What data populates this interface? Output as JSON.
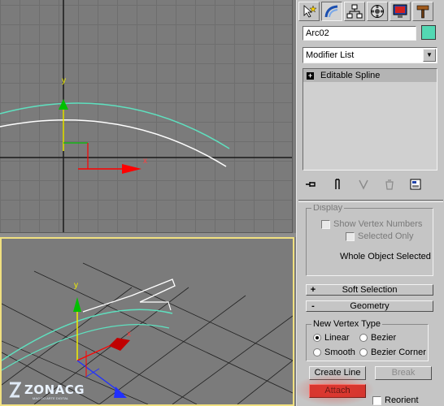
{
  "viewports": {
    "top": {
      "axis_y_label": "y",
      "axis_x_label": "x"
    },
    "perspective": {
      "axis_y_label": "y",
      "axis_x_label": "x"
    }
  },
  "panel": {
    "tabs": [
      {
        "name": "create-tab",
        "icon": "pointer-star-icon"
      },
      {
        "name": "modify-tab",
        "icon": "modify-arc-icon"
      },
      {
        "name": "hierarchy-tab",
        "icon": "hierarchy-icon"
      },
      {
        "name": "motion-tab",
        "icon": "motion-icon"
      },
      {
        "name": "display-tab",
        "icon": "display-monitor-icon"
      },
      {
        "name": "utilities-tab",
        "icon": "hammer-icon"
      }
    ],
    "object_name": "Arc02",
    "object_color": "#53d8b3",
    "modifier_list": "Modifier List",
    "stack_items": [
      "Editable Spline"
    ],
    "display": {
      "title": "Display",
      "show_vertex_numbers": "Show Vertex Numbers",
      "selected_only": "Selected Only",
      "status": "Whole Object Selected"
    },
    "soft_selection": {
      "sign": "+",
      "title": "Soft Selection"
    },
    "geometry": {
      "sign": "-",
      "title": "Geometry",
      "new_vertex_type": "New Vertex Type",
      "linear": "Linear",
      "bezier": "Bezier",
      "smooth": "Smooth",
      "bezier_corner": "Bezier Corner",
      "create_line": "Create Line",
      "break": "Break",
      "attach": "Attach",
      "reorient": "Reorient"
    }
  },
  "watermark": {
    "brand": "ZONACG",
    "tagline": "MAG DO ARTE DIGITAL"
  },
  "colors": {
    "spline_cyan": "#53d8b3",
    "axis_red": "#ff0000",
    "axis_green": "#00c000",
    "axis_blue": "#2030ff",
    "attach_active": "#d3352e"
  }
}
